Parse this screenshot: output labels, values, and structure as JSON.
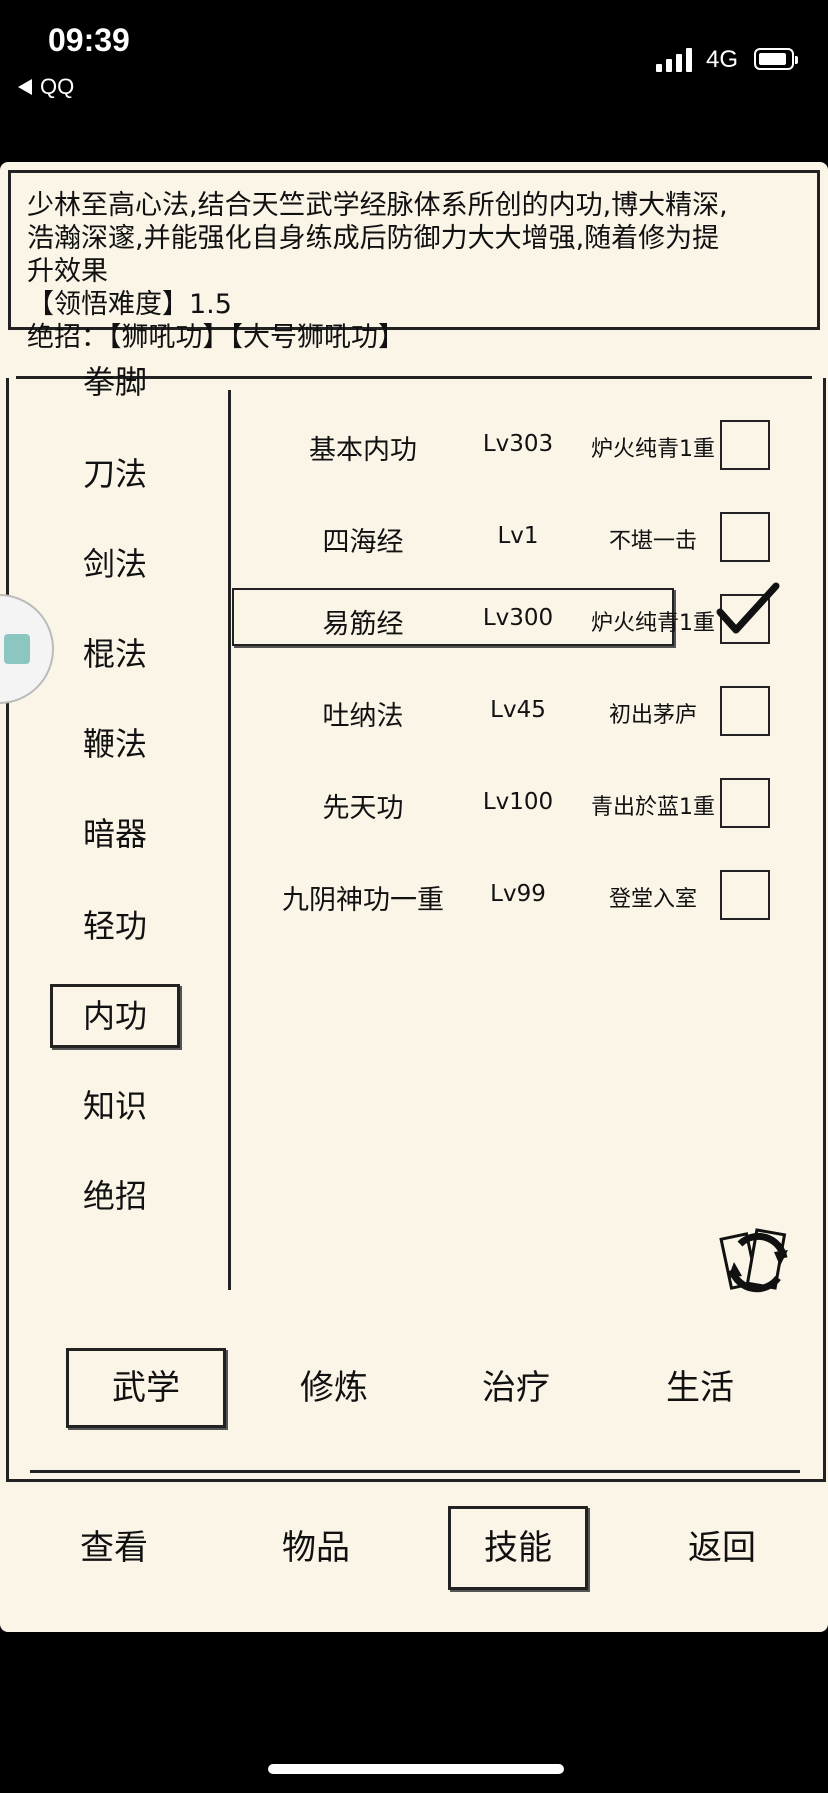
{
  "status_bar": {
    "time": "09:39",
    "back_app": "QQ",
    "network": "4G",
    "battery_level": 0.9
  },
  "description": {
    "lines": [
      "少林至高心法,结合天竺武学经脉体系所创的内功,博大精深,",
      "浩瀚深邃,并能强化自身练成后防御力大大增强,随着修为提",
      "升效果",
      "【领悟难度】1.5",
      "绝招：【狮吼功】【大号狮吼功】"
    ]
  },
  "categories": [
    {
      "label": "拳脚",
      "selected": false
    },
    {
      "label": "刀法",
      "selected": false
    },
    {
      "label": "剑法",
      "selected": false
    },
    {
      "label": "棍法",
      "selected": false
    },
    {
      "label": "鞭法",
      "selected": false
    },
    {
      "label": "暗器",
      "selected": false
    },
    {
      "label": "轻功",
      "selected": false
    },
    {
      "label": "内功",
      "selected": true
    },
    {
      "label": "知识",
      "selected": false
    },
    {
      "label": "绝招",
      "selected": false
    }
  ],
  "skills": [
    {
      "name": "基本内功",
      "level": "Lv303",
      "stage": "炉火纯青1重",
      "checked": false,
      "selected": false
    },
    {
      "name": "四海经",
      "level": "Lv1",
      "stage": "不堪一击",
      "checked": false,
      "selected": false
    },
    {
      "name": "易筋经",
      "level": "Lv300",
      "stage": "炉火纯青1重",
      "checked": true,
      "selected": true
    },
    {
      "name": "吐纳法",
      "level": "Lv45",
      "stage": "初出茅庐",
      "checked": false,
      "selected": false
    },
    {
      "name": "先天功",
      "level": "Lv100",
      "stage": "青出於蓝1重",
      "checked": false,
      "selected": false
    },
    {
      "name": "九阴神功一重",
      "level": "Lv99",
      "stage": "登堂入室",
      "checked": false,
      "selected": false
    }
  ],
  "tabs": [
    {
      "label": "武学",
      "selected": true
    },
    {
      "label": "修炼",
      "selected": false
    },
    {
      "label": "治疗",
      "selected": false
    },
    {
      "label": "生活",
      "selected": false
    }
  ],
  "nav": [
    {
      "label": "查看",
      "selected": false
    },
    {
      "label": "物品",
      "selected": false
    },
    {
      "label": "技能",
      "selected": true
    },
    {
      "label": "返回",
      "selected": false
    }
  ],
  "icons": {
    "refresh": "refresh-icon",
    "check": "checkmark-icon",
    "back": "back-arrow-icon"
  }
}
